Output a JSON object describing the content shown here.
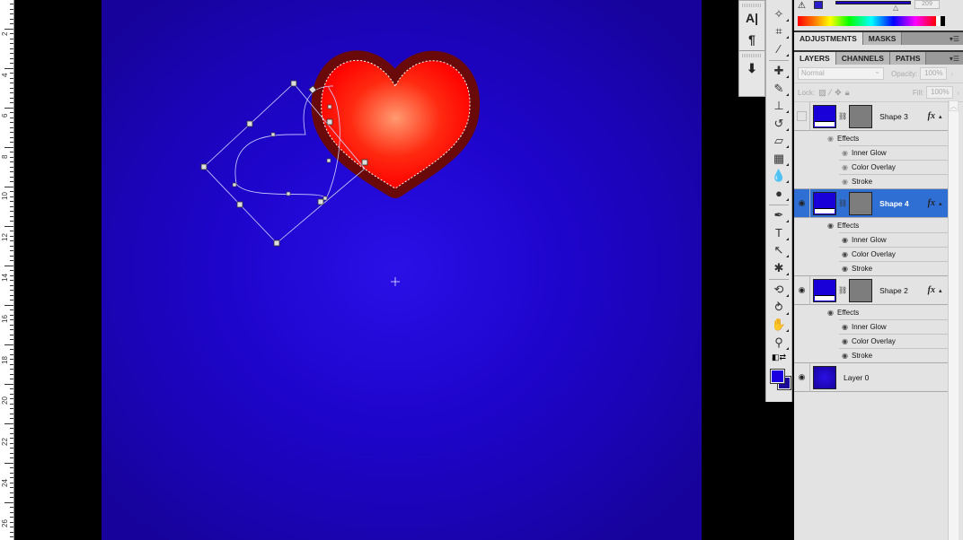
{
  "ruler": {
    "labels": [
      "2",
      "4",
      "6",
      "8",
      "10",
      "12",
      "14",
      "16",
      "18",
      "20",
      "22",
      "24",
      "26"
    ]
  },
  "mini_panel": {
    "icons": [
      "character-panel-icon",
      "paragraph-panel-icon",
      "3d-panel-icon"
    ],
    "glyphs": [
      "A|",
      "¶",
      "⬇"
    ]
  },
  "toolbar": {
    "tools": [
      {
        "name": "magic-wand-icon",
        "glyph": "✧"
      },
      {
        "name": "crop-icon",
        "glyph": "⌗"
      },
      {
        "name": "eyedropper-icon",
        "glyph": "⁄"
      },
      {
        "name": "healing-brush-icon",
        "glyph": "✚"
      },
      {
        "name": "brush-icon",
        "glyph": "✎"
      },
      {
        "name": "clone-stamp-icon",
        "glyph": "⊥"
      },
      {
        "name": "history-brush-icon",
        "glyph": "↺"
      },
      {
        "name": "eraser-icon",
        "glyph": "▱"
      },
      {
        "name": "gradient-icon",
        "glyph": "▦"
      },
      {
        "name": "blur-icon",
        "glyph": "💧"
      },
      {
        "name": "dodge-icon",
        "glyph": "●"
      },
      {
        "name": "pen-icon",
        "glyph": "✒"
      },
      {
        "name": "type-icon",
        "glyph": "T"
      },
      {
        "name": "path-selection-icon",
        "glyph": "↖"
      },
      {
        "name": "custom-shape-icon",
        "glyph": "✱"
      },
      {
        "name": "3d-rotate-icon",
        "glyph": "⟲"
      },
      {
        "name": "3d-orbit-icon",
        "glyph": "⥁"
      },
      {
        "name": "hand-icon",
        "glyph": "✋"
      },
      {
        "name": "zoom-icon",
        "glyph": "⚲"
      }
    ],
    "foreground_color": "#1a00e0",
    "background_color": "#1d0a9a",
    "quick_mask_glyph": "◘"
  },
  "color_panel": {
    "warning_glyph": "⚠",
    "value": "209",
    "thumb_glyph": "△"
  },
  "adjust_tabs": [
    "ADJUSTMENTS",
    "MASKS"
  ],
  "layer_tabs": [
    "LAYERS",
    "CHANNELS",
    "PATHS"
  ],
  "layer_options": {
    "blend_mode": "Normal",
    "opacity_label": "Opacity:",
    "opacity": "100%",
    "lock_label": "Lock:",
    "fill_label": "Fill:",
    "fill": "100%"
  },
  "layers": [
    {
      "name": "Shape 3",
      "visible": false,
      "selected": false,
      "fx": "fx",
      "effects_label": "Effects",
      "effects": [
        "Inner Glow",
        "Color Overlay",
        "Stroke"
      ]
    },
    {
      "name": "Shape 4",
      "visible": true,
      "selected": true,
      "fx": "fx",
      "effects_label": "Effects",
      "effects": [
        "Inner Glow",
        "Color Overlay",
        "Stroke"
      ]
    },
    {
      "name": "Shape 2",
      "visible": true,
      "selected": false,
      "fx": "fx",
      "effects_label": "Effects",
      "effects": [
        "Inner Glow",
        "Color Overlay",
        "Stroke"
      ]
    },
    {
      "name": "Layer 0",
      "visible": true,
      "selected": false
    }
  ],
  "canvas": {
    "background_color": "#1e05cc",
    "heart_fill": "#ff1a00",
    "heart_highlight": "#ff8a66",
    "heart_stroke": "#6b0a0a"
  }
}
